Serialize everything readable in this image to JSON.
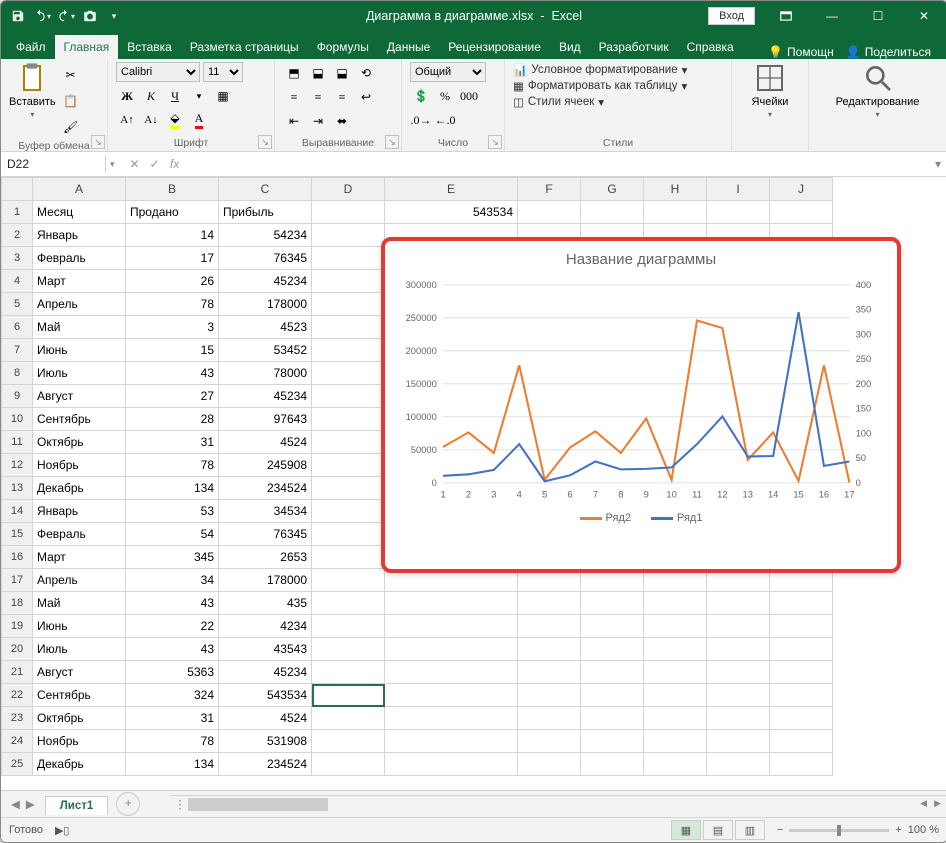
{
  "title_doc": "Диаграмма в диаграмме.xlsx",
  "title_app": "Excel",
  "login_label": "Вход",
  "tabs": [
    "Файл",
    "Главная",
    "Вставка",
    "Разметка страницы",
    "Формулы",
    "Данные",
    "Рецензирование",
    "Вид",
    "Разработчик",
    "Справка"
  ],
  "active_tab": "Главная",
  "help_label": "Помощн",
  "share_label": "Поделиться",
  "groups": {
    "clipboard": "Буфер обмена",
    "paste": "Вставить",
    "font": "Шрифт",
    "align": "Выравнивание",
    "number": "Число",
    "styles": "Стили",
    "cells": "Ячейки",
    "editing": "Редактирование"
  },
  "font_name": "Calibri",
  "font_size": "11",
  "number_format": "Общий",
  "styles_items": [
    "Условное форматирование",
    "Форматировать как таблицу",
    "Стили ячеек"
  ],
  "namebox_value": "D22",
  "columns": [
    "A",
    "B",
    "C",
    "D",
    "E",
    "F",
    "G",
    "H",
    "I",
    "J"
  ],
  "headers": {
    "A": "Месяц",
    "B": "Продано",
    "C": "Прибыль"
  },
  "e1_value": "543534",
  "rows": [
    [
      "Январь",
      14,
      54234
    ],
    [
      "Февраль",
      17,
      76345
    ],
    [
      "Март",
      26,
      45234
    ],
    [
      "Апрель",
      78,
      178000
    ],
    [
      "Май",
      3,
      4523
    ],
    [
      "Июнь",
      15,
      53452
    ],
    [
      "Июль",
      43,
      78000
    ],
    [
      "Август",
      27,
      45234
    ],
    [
      "Сентябрь",
      28,
      97643
    ],
    [
      "Октябрь",
      31,
      4524
    ],
    [
      "Ноябрь",
      78,
      245908
    ],
    [
      "Декабрь",
      134,
      234524
    ],
    [
      "Январь",
      53,
      34534
    ],
    [
      "Февраль",
      54,
      76345
    ],
    [
      "Март",
      345,
      2653
    ],
    [
      "Апрель",
      34,
      178000
    ],
    [
      "Май",
      43,
      435
    ],
    [
      "Июнь",
      22,
      4234
    ],
    [
      "Июль",
      43,
      43543
    ],
    [
      "Август",
      5363,
      45234
    ],
    [
      "Сентябрь",
      324,
      543534
    ],
    [
      "Октябрь",
      31,
      4524
    ],
    [
      "Ноябрь",
      78,
      531908
    ],
    [
      "Декабрь",
      134,
      234524
    ]
  ],
  "sheet_tab": "Лист1",
  "status_text": "Готово",
  "zoom_text": "100 %",
  "chart_data": {
    "type": "line",
    "title": "Название диаграммы",
    "x": [
      1,
      2,
      3,
      4,
      5,
      6,
      7,
      8,
      9,
      10,
      11,
      12,
      13,
      14,
      15,
      16,
      17
    ],
    "left_axis": {
      "label": "",
      "min": 0,
      "max": 300000,
      "ticks": [
        0,
        50000,
        100000,
        150000,
        200000,
        250000,
        300000
      ]
    },
    "right_axis": {
      "label": "",
      "min": 0,
      "max": 400,
      "ticks": [
        0,
        50,
        100,
        150,
        200,
        250,
        300,
        350,
        400
      ]
    },
    "series": [
      {
        "name": "Ряд2",
        "axis": "left",
        "color": "#ed7d31",
        "values": [
          54234,
          76345,
          45234,
          178000,
          4523,
          53452,
          78000,
          45234,
          97643,
          4524,
          245908,
          234524,
          34534,
          76345,
          2653,
          178000,
          435
        ]
      },
      {
        "name": "Ряд1",
        "axis": "right",
        "color": "#4472c4",
        "values": [
          14,
          17,
          26,
          78,
          3,
          15,
          43,
          27,
          28,
          31,
          78,
          134,
          53,
          54,
          345,
          34,
          43
        ]
      }
    ],
    "legend": [
      "Ряд2",
      "Ряд1"
    ]
  }
}
